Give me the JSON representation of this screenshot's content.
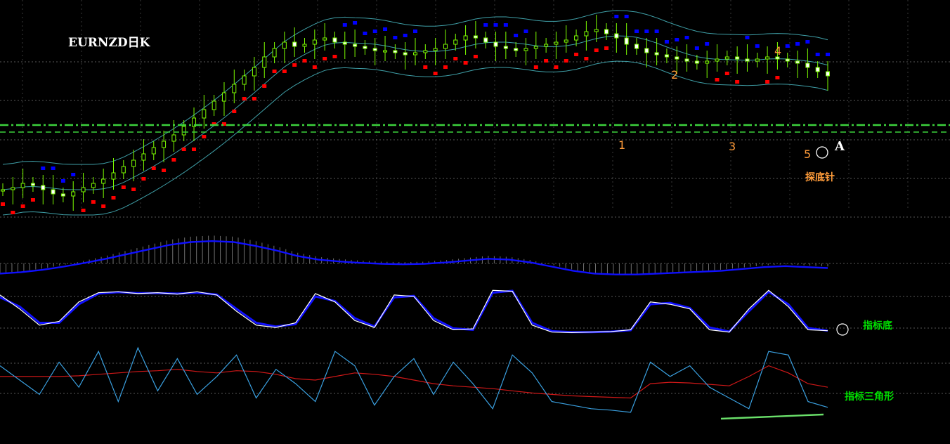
{
  "title": "EURNZD日K",
  "colors": {
    "background": "#000000",
    "candle": "#7CFC00",
    "candle_body_bear": "#ffffff",
    "bollinger": "#3fa0a8",
    "parabolic_up": "#ff0000",
    "parabolic_down": "#0000ff",
    "support_line": "#3cd23c",
    "macd_signal": "#1010ff",
    "histogram": "#707070",
    "stoch_k": "#ffffff",
    "stoch_d": "#1010ff",
    "rsi": "#3aa0e0",
    "rsi_avg": "#d01818",
    "annotation_numbers": "#ff9c3a",
    "indicator_labels": "#00e000",
    "trend_line": "#6ae06a",
    "grid": "#ffffff"
  },
  "annotations": {
    "wave_labels": [
      "1",
      "2",
      "3",
      "4",
      "5"
    ],
    "point_label": "A",
    "pin_bar_label": "探底针",
    "indicator_bottom_label": "指标底",
    "indicator_triangle_label": "指标三角形"
  },
  "chart_data": [
    {
      "type": "candlestick",
      "name": "",
      "title": "EURNZD日K",
      "overlays": [
        "bollinger_bands",
        "parabolic_sar",
        "horizontal_support_lines"
      ],
      "close": [
        0.3,
        0.31,
        0.33,
        0.32,
        0.3,
        0.28,
        0.27,
        0.29,
        0.31,
        0.33,
        0.35,
        0.38,
        0.41,
        0.44,
        0.47,
        0.5,
        0.53,
        0.56,
        0.6,
        0.64,
        0.68,
        0.72,
        0.76,
        0.8,
        0.84,
        0.88,
        0.93,
        0.97,
        1.0,
        0.98,
        0.99,
        1.01,
        1.02,
        1.0,
        0.99,
        0.98,
        0.97,
        0.96,
        0.96,
        0.95,
        0.94,
        0.95,
        0.96,
        0.97,
        0.99,
        1.01,
        1.03,
        1.02,
        1.0,
        0.98,
        0.97,
        0.96,
        0.97,
        0.98,
        0.99,
        1.0,
        1.01,
        1.03,
        1.05,
        1.06,
        1.04,
        1.02,
        0.99,
        0.97,
        0.95,
        0.94,
        0.93,
        0.92,
        0.91,
        0.9,
        0.91,
        0.92,
        0.93,
        0.92,
        0.91,
        0.92,
        0.93,
        0.92,
        0.91,
        0.9,
        0.88,
        0.86,
        0.84
      ],
      "levels_shown": [
        "support_dash_dot",
        "support_dashed"
      ]
    },
    {
      "type": "line",
      "name": "",
      "series": [
        {
          "values": [
            0.1,
            0.13,
            0.18,
            0.25,
            0.33,
            0.42,
            0.52,
            0.62,
            0.72,
            0.78,
            0.8,
            0.78,
            0.7,
            0.6,
            0.48,
            0.4,
            0.36,
            0.33,
            0.31,
            0.3,
            0.31,
            0.34,
            0.38,
            0.42,
            0.4,
            0.34,
            0.25,
            0.16,
            0.1,
            0.08,
            0.08,
            0.1,
            0.12,
            0.14,
            0.16,
            0.2,
            0.24,
            0.26,
            0.24,
            0.22
          ]
        }
      ],
      "histogram": "vertical bars around zero line"
    },
    {
      "type": "line",
      "name": "",
      "series": [
        {
          "values": [
            0.85,
            0.55,
            0.2,
            0.28,
            0.7,
            0.9,
            0.92,
            0.88,
            0.9,
            0.87,
            0.92,
            0.85,
            0.5,
            0.2,
            0.15,
            0.25,
            0.88,
            0.7,
            0.3,
            0.15,
            0.85,
            0.82,
            0.3,
            0.1,
            0.12,
            0.95,
            0.93,
            0.2,
            0.05,
            0.04,
            0.05,
            0.06,
            0.1,
            0.7,
            0.65,
            0.55,
            0.1,
            0.05,
            0.55,
            0.95,
            0.6,
            0.1,
            0.08
          ]
        },
        {
          "values": [
            0.8,
            0.6,
            0.25,
            0.25,
            0.65,
            0.88,
            0.91,
            0.89,
            0.89,
            0.88,
            0.9,
            0.86,
            0.55,
            0.25,
            0.17,
            0.22,
            0.82,
            0.72,
            0.35,
            0.17,
            0.8,
            0.83,
            0.35,
            0.13,
            0.1,
            0.9,
            0.94,
            0.25,
            0.07,
            0.05,
            0.05,
            0.06,
            0.09,
            0.65,
            0.68,
            0.57,
            0.15,
            0.06,
            0.5,
            0.92,
            0.65,
            0.14,
            0.08
          ]
        }
      ]
    },
    {
      "type": "line",
      "name": "",
      "series": [
        {
          "values": [
            0.7,
            0.5,
            0.3,
            0.75,
            0.4,
            0.9,
            0.2,
            0.95,
            0.35,
            0.8,
            0.3,
            0.55,
            0.85,
            0.25,
            0.65,
            0.45,
            0.2,
            0.9,
            0.7,
            0.15,
            0.55,
            0.8,
            0.3,
            0.75,
            0.45,
            0.1,
            0.85,
            0.6,
            0.2,
            0.15,
            0.1,
            0.08,
            0.05,
            0.75,
            0.55,
            0.7,
            0.4,
            0.25,
            0.1,
            0.9,
            0.85,
            0.2,
            0.12
          ]
        },
        {
          "values": [
            0.55,
            0.55,
            0.55,
            0.55,
            0.56,
            0.58,
            0.6,
            0.62,
            0.63,
            0.65,
            0.62,
            0.6,
            0.63,
            0.62,
            0.58,
            0.52,
            0.5,
            0.55,
            0.6,
            0.58,
            0.55,
            0.5,
            0.45,
            0.42,
            0.4,
            0.38,
            0.35,
            0.32,
            0.3,
            0.28,
            0.27,
            0.26,
            0.25,
            0.45,
            0.47,
            0.46,
            0.44,
            0.42,
            0.55,
            0.7,
            0.6,
            0.45,
            0.4
          ]
        }
      ],
      "trend_line": "rising support under lows"
    }
  ]
}
